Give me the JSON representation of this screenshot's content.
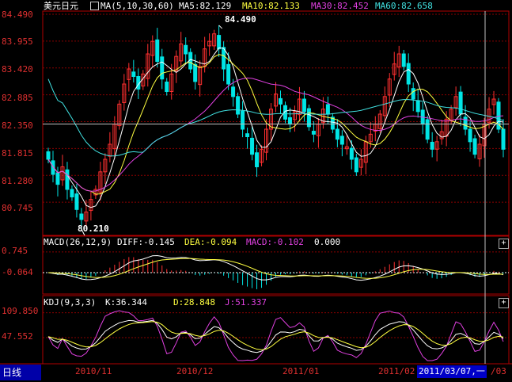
{
  "main_panel": {
    "instrument": "美元日元",
    "ma_header": "MA(5,10,30,60)",
    "ma5": "MA5:82.129",
    "ma10": "MA10:82.133",
    "ma30": "MA30:82.452",
    "ma60": "MA60:82.658",
    "high_marker": "84.490",
    "low_marker": "80.210",
    "y_ticks": [
      "84.490",
      "83.955",
      "83.420",
      "82.885",
      "82.350",
      "81.815",
      "81.280",
      "80.745"
    ]
  },
  "macd_panel": {
    "header": "MACD(26,12,9)",
    "diff": "DIFF:-0.145",
    "dea": "DEA:-0.094",
    "macd": "MACD:-0.102",
    "extra": "0.000",
    "y_ticks": [
      "0.745",
      "-0.064"
    ],
    "button": "+"
  },
  "kdj_panel": {
    "header": "KDJ(9,3,3)",
    "k": "K:36.344",
    "d": "D:28.848",
    "j": "J:51.337",
    "y_ticks": [
      "109.850",
      "47.552"
    ],
    "button": "+"
  },
  "bottom_bar": {
    "period": "日线",
    "dates": [
      "2010/11",
      "2010/12",
      "2011/01",
      "2011/02"
    ],
    "cursor_date": "2011/03/07,一",
    "tail": "/03"
  },
  "colors": {
    "up": "#ff3030",
    "down": "#00e5e5",
    "ma5": "#ffffff",
    "ma10": "#ffff40",
    "ma30": "#e040e0",
    "ma60": "#40e0e0",
    "axis": "#b00000",
    "grid": "#8a0000"
  },
  "chart_data": [
    {
      "type": "candlestick",
      "title": "美元日元",
      "ylim": [
        80.21,
        84.49
      ],
      "high": 84.49,
      "low": 80.21,
      "close": [
        81.6,
        81.3,
        81.1,
        81.45,
        81.0,
        80.85,
        80.6,
        80.4,
        80.55,
        80.8,
        81.0,
        81.35,
        81.6,
        81.9,
        82.3,
        82.7,
        83.1,
        83.4,
        83.25,
        83.0,
        83.3,
        83.7,
        83.95,
        83.55,
        83.2,
        82.95,
        83.3,
        83.65,
        83.9,
        83.7,
        83.4,
        83.15,
        83.45,
        83.8,
        83.95,
        84.1,
        83.8,
        83.4,
        83.1,
        82.85,
        82.5,
        82.2,
        82.05,
        81.7,
        81.45,
        81.8,
        82.2,
        82.6,
        82.9,
        82.7,
        82.4,
        82.3,
        82.55,
        82.8,
        82.55,
        82.25,
        82.1,
        82.3,
        82.6,
        82.5,
        82.2,
        82.0,
        81.9,
        81.85,
        81.6,
        81.35,
        81.6,
        81.95,
        82.1,
        82.3,
        82.5,
        82.85,
        83.2,
        83.5,
        83.7,
        83.45,
        83.1,
        82.8,
        82.55,
        82.3,
        82.0,
        81.8,
        81.95,
        82.15,
        82.4,
        82.6,
        82.85,
        82.5,
        82.2,
        81.95,
        81.7,
        81.9,
        82.3,
        82.6,
        82.8,
        82.2,
        81.8
      ]
    },
    {
      "type": "line",
      "title": "MACD(26,12,9)",
      "series": [
        {
          "name": "DIFF",
          "last": -0.145
        },
        {
          "name": "DEA",
          "last": -0.094
        },
        {
          "name": "MACD",
          "last": -0.102
        }
      ],
      "y_ticks": [
        0.745,
        -0.064
      ]
    },
    {
      "type": "line",
      "title": "KDJ(9,3,3)",
      "series": [
        {
          "name": "K",
          "last": 36.344
        },
        {
          "name": "D",
          "last": 28.848
        },
        {
          "name": "J",
          "last": 51.337
        }
      ],
      "y_ticks": [
        109.85,
        47.552
      ]
    }
  ]
}
